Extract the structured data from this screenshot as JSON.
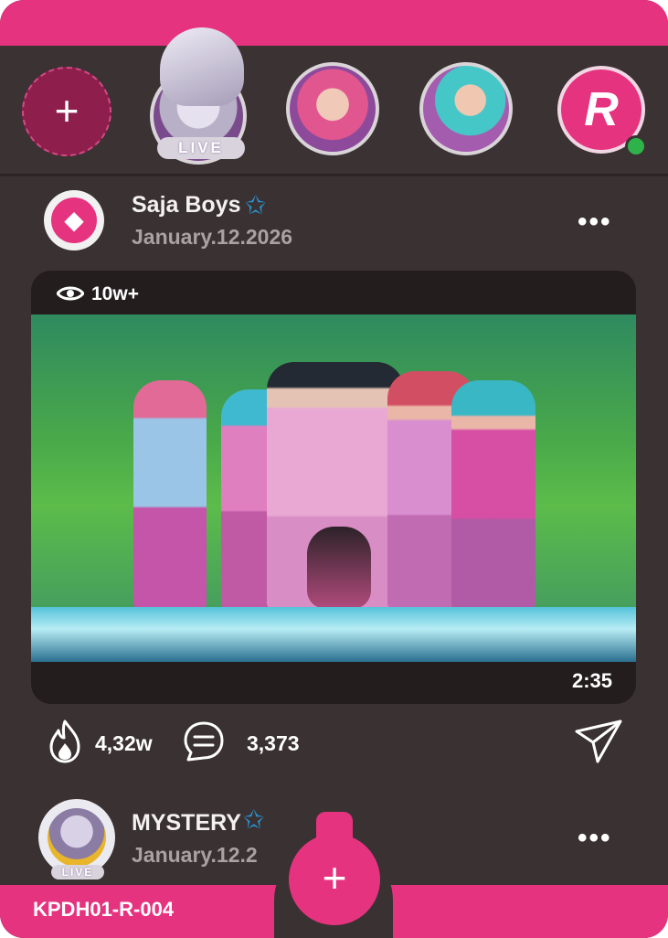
{
  "stories": {
    "add_label": "+",
    "live_label": "LIVE",
    "brand_letter": "R"
  },
  "post": {
    "author": "Saja Boys",
    "date": "January.12.2026",
    "views": "10w+",
    "duration": "2:35",
    "likes": "4,32w",
    "comments": "3,373"
  },
  "post2": {
    "author": "MYSTERY",
    "date": "January.12.2",
    "live_label": "LIVE"
  },
  "footer": {
    "code": "KPDH01-R-004",
    "fab_label": "+"
  },
  "colors": {
    "accent": "#e6337f",
    "background": "#3a3132",
    "verified": "#2a97d8",
    "online": "#2db34a"
  }
}
